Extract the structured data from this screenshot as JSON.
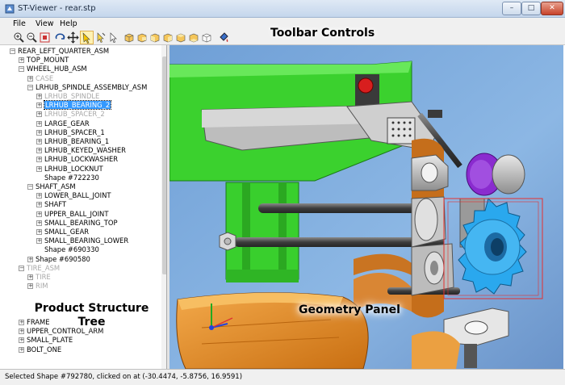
{
  "window": {
    "title": "ST-Viewer - rear.stp"
  },
  "window_buttons": {
    "minimize": "–",
    "maximize": "□",
    "close": "✕"
  },
  "menu": [
    {
      "label": "File"
    },
    {
      "label": "View"
    },
    {
      "label": "Help"
    }
  ],
  "toolbar": {
    "icons": [
      "zoom-in-icon",
      "zoom-out-icon",
      "zoom-fit-icon",
      "rotate-icon",
      "pan-icon",
      "select-icon",
      "pick-icon",
      "pointer-icon",
      "view-cube-front-icon",
      "view-cube-back-icon",
      "view-cube-left-icon",
      "view-cube-right-icon",
      "view-cube-top-icon",
      "view-cube-bottom-icon",
      "view-cube-iso-icon",
      "paint-icon"
    ],
    "active": "select-icon"
  },
  "annotations": {
    "toolbar": "Toolbar Controls",
    "tree_line1": "Product Structure",
    "tree_line2": "Tree",
    "geometry": "Geometry Panel"
  },
  "tree": [
    {
      "label": "REAR_LEFT_QUARTER_ASM",
      "exp": "minus",
      "state": "normal",
      "depth": 0
    },
    {
      "label": "TOP_MOUNT",
      "exp": "plus",
      "state": "normal",
      "depth": 1
    },
    {
      "label": "WHEEL_HUB_ASM",
      "exp": "minus",
      "state": "normal",
      "depth": 1
    },
    {
      "label": "CASE",
      "exp": "plus",
      "state": "grey",
      "depth": 2
    },
    {
      "label": "LRHUB_SPINDLE_ASSEMBLY_ASM",
      "exp": "minus",
      "state": "normal",
      "depth": 2
    },
    {
      "label": "LRHUB_SPINDLE",
      "exp": "plus",
      "state": "grey",
      "depth": 3
    },
    {
      "label": "LRHUB_BEARING_2",
      "exp": "plus",
      "state": "selected",
      "depth": 3
    },
    {
      "label": "LRHUB_SPACER_2",
      "exp": "plus",
      "state": "grey",
      "depth": 3
    },
    {
      "label": "LARGE_GEAR",
      "exp": "plus",
      "state": "normal",
      "depth": 3
    },
    {
      "label": "LRHUB_SPACER_1",
      "exp": "plus",
      "state": "normal",
      "depth": 3
    },
    {
      "label": "LRHUB_BEARING_1",
      "exp": "plus",
      "state": "normal",
      "depth": 3
    },
    {
      "label": "LRHUB_KEYED_WASHER",
      "exp": "plus",
      "state": "normal",
      "depth": 3
    },
    {
      "label": "LRHUB_LOCKWASHER",
      "exp": "plus",
      "state": "normal",
      "depth": 3
    },
    {
      "label": "LRHUB_LOCKNUT",
      "exp": "plus",
      "state": "normal",
      "depth": 3
    },
    {
      "label": "Shape #722230",
      "exp": "none",
      "state": "normal",
      "depth": 3
    },
    {
      "label": "SHAFT_ASM",
      "exp": "minus",
      "state": "normal",
      "depth": 2
    },
    {
      "label": "LOWER_BALL_JOINT",
      "exp": "plus",
      "state": "normal",
      "depth": 3
    },
    {
      "label": "SHAFT",
      "exp": "plus",
      "state": "normal",
      "depth": 3
    },
    {
      "label": "UPPER_BALL_JOINT",
      "exp": "plus",
      "state": "normal",
      "depth": 3
    },
    {
      "label": "SMALL_BEARING_TOP",
      "exp": "plus",
      "state": "normal",
      "depth": 3
    },
    {
      "label": "SMALL_GEAR",
      "exp": "plus",
      "state": "normal",
      "depth": 3
    },
    {
      "label": "SMALL_BEARING_LOWER",
      "exp": "plus",
      "state": "normal",
      "depth": 3
    },
    {
      "label": "Shape #690330",
      "exp": "none",
      "state": "normal",
      "depth": 3
    },
    {
      "label": "Shape #690580",
      "exp": "plus",
      "state": "normal",
      "depth": 2
    },
    {
      "label": "TIRE_ASM",
      "exp": "minus",
      "state": "grey",
      "depth": 1
    },
    {
      "label": "TIRE",
      "exp": "plus",
      "state": "grey",
      "depth": 2
    },
    {
      "label": "RIM",
      "exp": "plus",
      "state": "grey",
      "depth": 2
    },
    {
      "label": "",
      "exp": "none",
      "state": "normal",
      "depth": 2
    },
    {
      "label": "",
      "exp": "none",
      "state": "normal",
      "depth": 2
    },
    {
      "label": "",
      "exp": "none",
      "state": "normal",
      "depth": 2
    },
    {
      "label": "FRAME",
      "exp": "plus",
      "state": "normal",
      "depth": 1
    },
    {
      "label": "UPPER_CONTROL_ARM",
      "exp": "plus",
      "state": "normal",
      "depth": 1
    },
    {
      "label": "SMALL_PLATE",
      "exp": "plus",
      "state": "normal",
      "depth": 1
    },
    {
      "label": "BOLT_ONE",
      "exp": "plus",
      "state": "normal",
      "depth": 1
    }
  ],
  "status": {
    "text": "Selected Shape #792780, clicked on at (-30.4474, -5.8756, 16.9591)"
  },
  "colors": {
    "selection": "#3399ff",
    "gear": "#2aa8ee",
    "arm": "#35dd2c",
    "bounding_box": "#e53030"
  }
}
